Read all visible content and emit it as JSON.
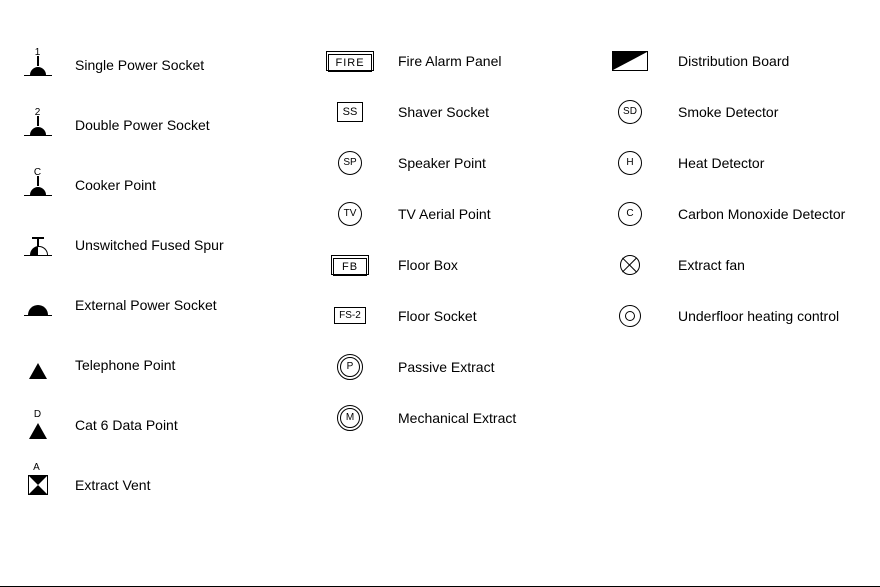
{
  "col1": [
    {
      "sup": "1",
      "label": "Single Power Socket"
    },
    {
      "sup": "2",
      "label": "Double Power Socket"
    },
    {
      "sup": "C",
      "label": "Cooker Point"
    },
    {
      "sup": "",
      "label": "Unswitched Fused Spur"
    },
    {
      "sup": "",
      "label": "External Power Socket"
    },
    {
      "sup": "",
      "label": "Telephone Point"
    },
    {
      "sup": "D",
      "label": "Cat 6 Data Point"
    },
    {
      "sup": "A",
      "label": "Extract Vent"
    }
  ],
  "col2": [
    {
      "txt": "FIRE",
      "label": "Fire Alarm Panel"
    },
    {
      "txt": "SS",
      "label": "Shaver Socket"
    },
    {
      "txt": "SP",
      "label": "Speaker Point"
    },
    {
      "txt": "TV",
      "label": "TV Aerial Point"
    },
    {
      "txt": "FB",
      "label": "Floor Box"
    },
    {
      "txt": "FS-2",
      "label": "Floor Socket"
    },
    {
      "txt": "P",
      "label": "Passive Extract"
    },
    {
      "txt": "M",
      "label": "Mechanical Extract"
    }
  ],
  "col3": [
    {
      "txt": "",
      "label": "Distribution Board"
    },
    {
      "txt": "SD",
      "label": "Smoke Detector"
    },
    {
      "txt": "H",
      "label": "Heat Detector"
    },
    {
      "txt": "C",
      "label": "Carbon Monoxide Detector"
    },
    {
      "txt": "",
      "label": "Extract fan"
    },
    {
      "txt": "",
      "label": "Underfloor heating control"
    }
  ]
}
